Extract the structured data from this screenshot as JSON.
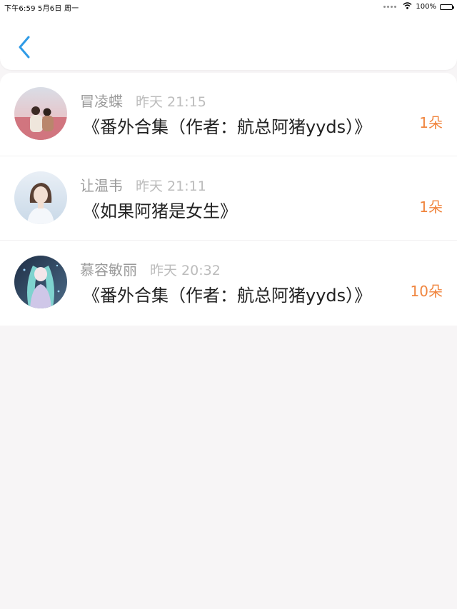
{
  "status_bar": {
    "datetime": "下午6:59   5月6日 周一",
    "battery": "100%"
  },
  "nav": {
    "back_icon": "chevron-left-icon",
    "accent": "#2f9be6"
  },
  "colors": {
    "count": "#f0853e",
    "name": "#9a9a9a",
    "time": "#bcbcbc"
  },
  "items": [
    {
      "name": "冒凌蝶",
      "time": "昨天 21:15",
      "title": "《番外合集（作者：航总阿猪yyds）》",
      "count": "1朵"
    },
    {
      "name": "让温韦",
      "time": "昨天 21:11",
      "title": "《如果阿猪是女生》",
      "count": "1朵"
    },
    {
      "name": "慕容敏丽",
      "time": "昨天 20:32",
      "title": "《番外合集（作者：航总阿猪yyds）》",
      "count": "10朵"
    }
  ]
}
